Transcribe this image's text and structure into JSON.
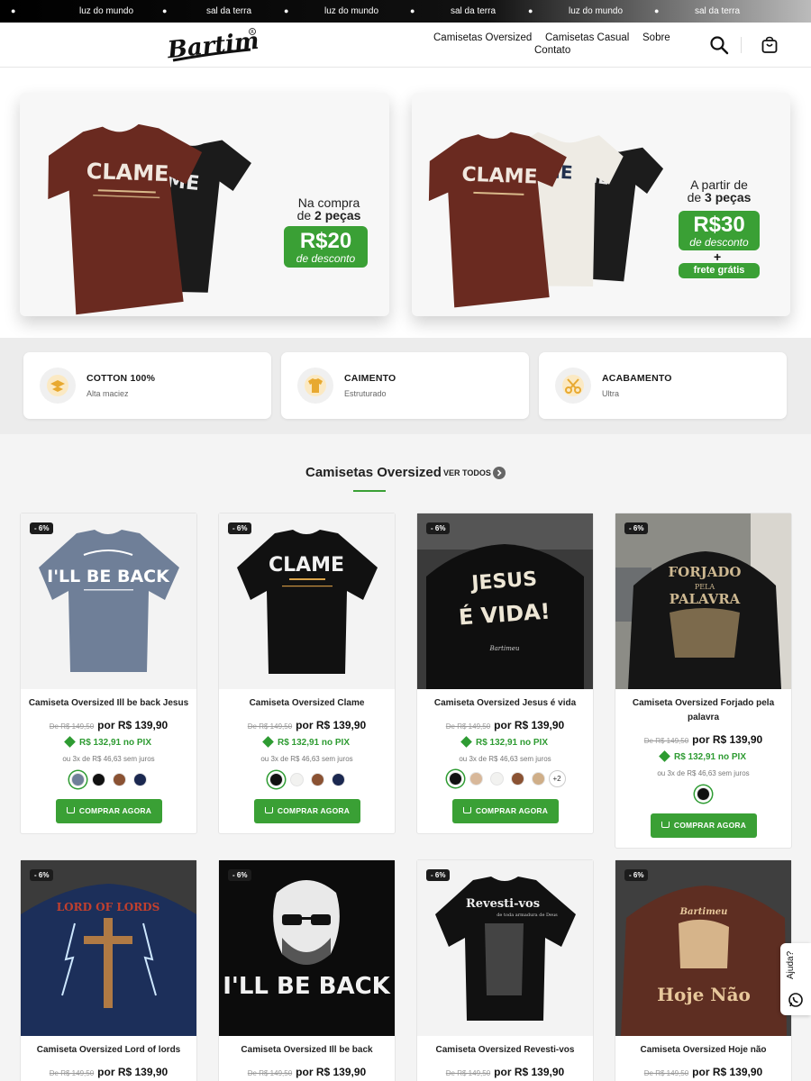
{
  "marquee": {
    "items": [
      "luz do mundo",
      "sal da terra",
      "luz do mundo",
      "sal da terra",
      "luz do mundo",
      "sal da terra"
    ]
  },
  "header": {
    "logo_text": "Bartimeu",
    "nav": [
      "Camisetas Oversized",
      "Camisetas Casual",
      "Sobre",
      "Contato"
    ]
  },
  "promos": [
    {
      "line1": "Na compra",
      "line2_prefix": "de ",
      "line2_bold": "2 peças",
      "price": "R$20",
      "price_sub": "de desconto",
      "shirt_text": "CLAME"
    },
    {
      "line1": "A partir de",
      "line2_prefix": "de ",
      "line2_bold": "3 peças",
      "price": "R$30",
      "price_sub": "de desconto",
      "plus": "+",
      "extra": "frete grátis",
      "shirt_text": "CLAME"
    }
  ],
  "features": [
    {
      "title": "COTTON 100%",
      "subtitle": "Alta maciez",
      "icon": "cotton-icon"
    },
    {
      "title": "CAIMENTO",
      "subtitle": "Estruturado",
      "icon": "shirt-fit-icon"
    },
    {
      "title": "ACABAMENTO",
      "subtitle": "Ultra",
      "icon": "scissors-icon"
    }
  ],
  "section": {
    "title": "Camisetas Oversized",
    "view_all": "VER TODOS"
  },
  "products": [
    {
      "badge": "- 6%",
      "name": "Camiseta Oversized Ill be back Jesus",
      "old_price": "De R$ 149,50",
      "price": "por R$ 139,90",
      "pix": "R$ 132,91  no PIX",
      "installments": "ou 3x de R$ 46,63 sem juros",
      "art": "I'LL BE BACK",
      "swatches": [
        "#6f7f98",
        "#111111",
        "#8a5233",
        "#1b2850"
      ],
      "more": ""
    },
    {
      "badge": "- 6%",
      "name": "Camiseta Oversized Clame",
      "old_price": "De R$ 149,50",
      "price": "por R$ 139,90",
      "pix": "R$ 132,91  no PIX",
      "installments": "ou 3x de R$ 46,63 sem juros",
      "art": "CLAME",
      "swatches": [
        "#111111",
        "#f2f2f0",
        "#8a5233",
        "#1b2850"
      ],
      "more": ""
    },
    {
      "badge": "- 6%",
      "name": "Camiseta Oversized Jesus é vida",
      "old_price": "De R$ 149,50",
      "price": "por R$ 139,90",
      "pix": "R$ 132,91  no PIX",
      "installments": "ou 3x de R$ 46,63 sem juros",
      "art": "JESUS É VIDA!",
      "swatches": [
        "#111111",
        "#d8b89a",
        "#f2f2f0",
        "#8a5233",
        "#cfae88"
      ],
      "more": "+2"
    },
    {
      "badge": "- 6%",
      "name": "Camiseta Oversized Forjado pela palavra",
      "old_price": "De R$ 149,50",
      "price": "por R$ 139,90",
      "pix": "R$ 132,91  no PIX",
      "installments": "ou 3x de R$ 46,63 sem juros",
      "art": "FORJADO PELA PALAVRA",
      "swatches": [
        "#111111"
      ],
      "more": ""
    },
    {
      "badge": "- 6%",
      "name": "Camiseta Oversized Lord of lords",
      "old_price": "De R$ 149,50",
      "price": "por R$ 139,90",
      "art": "LORD OF LORDS"
    },
    {
      "badge": "- 6%",
      "name": "Camiseta Oversized Ill be back",
      "old_price": "De R$ 149,50",
      "price": "por R$ 139,90",
      "art": "I'LL BE BACK"
    },
    {
      "badge": "- 6%",
      "name": "Camiseta Oversized Revesti-vos",
      "old_price": "De R$ 149,50",
      "price": "por R$ 139,90",
      "art": "Revesti-vos",
      "art_sub": "de toda armadura de Deus"
    },
    {
      "badge": "- 6%",
      "name": "Camiseta Oversized Hoje não",
      "old_price": "De R$ 149,50",
      "price": "por R$ 139,90",
      "art": "Hoje Não"
    }
  ],
  "buy_label": "COMPRAR AGORA",
  "help": {
    "label": "Ajuda?"
  },
  "colors": {
    "accent": "#3aa035",
    "pix": "#2e9b32",
    "header_bg": "#ffffff"
  }
}
